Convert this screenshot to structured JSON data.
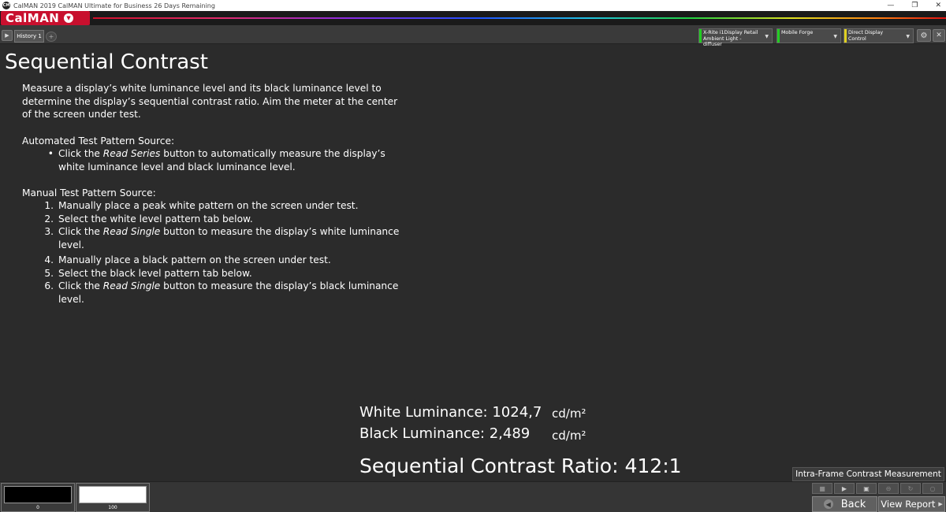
{
  "window": {
    "app_icon": "CM",
    "title": "CalMAN 2019 CalMAN Ultimate for Business 26 Days Remaining",
    "minimize": "—",
    "restore": "❐",
    "close": "✕"
  },
  "brand": {
    "logo": "CalMAN",
    "logo_caret": "▼"
  },
  "toolbar": {
    "nav_arrow": "▶",
    "tab_label": "History 1",
    "add_tab": "+",
    "devices": [
      {
        "line1": "X-Rite i1Display Retail",
        "line2": "Ambient Light - diffuser",
        "color": "#22cc22"
      },
      {
        "line1": "Mobile Forge",
        "line2": "",
        "color": "#22cc22"
      },
      {
        "line1": "Direct Display Control",
        "line2": "",
        "color": "#e0d020"
      }
    ],
    "dropdown_glyph": "▼",
    "settings_glyph": "⚙",
    "close_glyph": "✕"
  },
  "page": {
    "title": "Sequential Contrast",
    "description": "Measure a display’s white luminance level and its black luminance level to determine the display’s sequential contrast ratio. Aim the meter at the center of the screen under test.",
    "automated": {
      "heading": "Automated Test Pattern Source:",
      "bullet": "•",
      "item_pre": "Click the ",
      "item_em": "Read Series",
      "item_post": " button to automatically measure the display’s white luminance level and black luminance level."
    },
    "manual": {
      "heading": "Manual Test Pattern Source:",
      "steps": [
        {
          "num": "1.",
          "text": "Manually place a peak white pattern on the screen under test."
        },
        {
          "num": "2.",
          "text": "Select the white level pattern tab below."
        },
        {
          "num": "3.",
          "pre": "Click the ",
          "em": "Read Single",
          "post": " button to measure the display’s white luminance level."
        },
        {
          "num": "4.",
          "text": "Manually place a black pattern on the screen under test."
        },
        {
          "num": "5.",
          "text": "Select the black level pattern tab below."
        },
        {
          "num": "6.",
          "pre": "Click the ",
          "em": "Read Single",
          "post": " button to measure the display’s black luminance level."
        }
      ]
    }
  },
  "readings": {
    "white_label": "White Luminance:",
    "white_value": "1024,7",
    "white_unit": "cd/m²",
    "black_label": "Black Luminance:",
    "black_value": "2,489",
    "black_unit": "cd/m²",
    "ratio_label": "Sequential Contrast Ratio:",
    "ratio_value": "412:1"
  },
  "bottom": {
    "intra_button": "Intra-Frame Contrast Measurement",
    "swatches": [
      {
        "label": "0",
        "color": "#000000"
      },
      {
        "label": "100",
        "color": "#ffffff"
      }
    ],
    "controls": [
      "■",
      "▶",
      "▣",
      "⊖",
      "↻",
      "○"
    ],
    "back_icon": "◀",
    "back": "Back",
    "view_report": "View Report",
    "report_icon": "▶"
  }
}
